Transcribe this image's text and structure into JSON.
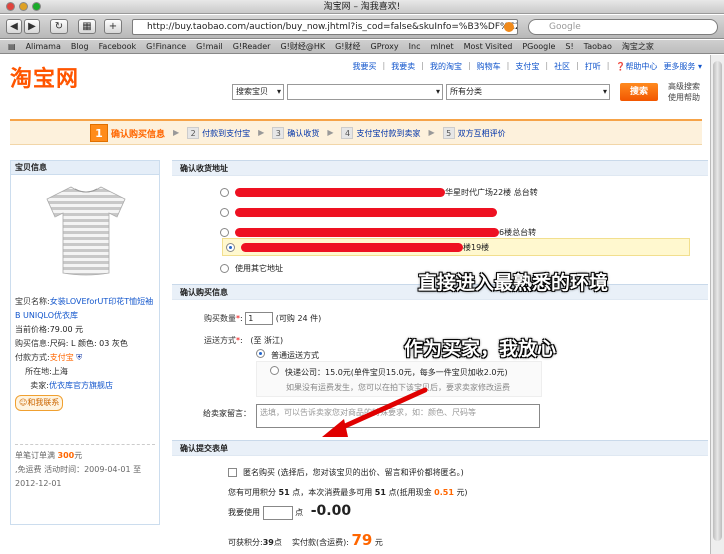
{
  "browser": {
    "window_title": "淘宝网 – 淘我喜欢!",
    "url": "http://buy.taobao.com/auction/buy_now.jhtml?is_cod=false&skuInfo=%B3%DF%C2%",
    "search_placeholder": "Google",
    "bookmarks": [
      "Alimama",
      "Blog",
      "Facebook",
      "G!Finance",
      "G!mail",
      "G!Reader",
      "G!财经@HK",
      "G!财经",
      "GProxy",
      "Inc",
      "mlnet",
      "Most Visited",
      "PGoogle",
      "S!",
      "Taobao",
      "淘宝之家"
    ]
  },
  "header": {
    "logo": "淘宝网",
    "nav": [
      "我要买",
      "我要卖",
      "我的淘宝",
      "购物车",
      "支付宝",
      "社区",
      "打听",
      "帮助中心",
      "更多服务"
    ],
    "search_type": "搜索宝贝",
    "category": "所有分类",
    "search_button": "搜索",
    "adv_search": "高级搜索",
    "help_link": "使用帮助"
  },
  "steps": [
    {
      "num": "1",
      "label": "确认购买信息",
      "active": true
    },
    {
      "num": "2",
      "label": "付款到支付宝"
    },
    {
      "num": "3",
      "label": "确认收货"
    },
    {
      "num": "4",
      "label": "支付宝付款到卖家"
    },
    {
      "num": "5",
      "label": "双方互相评价"
    }
  ],
  "product": {
    "header": "宝贝信息",
    "name_label": "宝贝名称:",
    "name": "女装LOVEforUT印花T恤短袖B UNIQLO优衣库",
    "price_label": "当前价格:",
    "price": "79.00 元",
    "attr_label": "购买信息:",
    "attr": "尺码: L 颜色: 03 灰色",
    "pay_label": "付款方式:",
    "pay": "支付宝",
    "loc_label": "所在地:",
    "loc": "上海",
    "seller_label": "卖家:",
    "seller": "优衣库官方旗舰店",
    "contact": "和我联系",
    "promo_line1_prefix": "单笔订单满 ",
    "promo_amount": "300",
    "promo_line1_suffix": "元",
    "promo_line2": ",免运费 活动时间：2009-04-01 至 2012-12-01"
  },
  "address": {
    "title": "确认收货地址",
    "rows": [
      {
        "text": "华星时代广场22楼 总台转",
        "selected": false
      },
      {
        "text": "",
        "selected": false
      },
      {
        "text": "6楼总台转",
        "selected": false
      },
      {
        "text": "楼19楼",
        "selected": true
      }
    ],
    "other": "使用其它地址"
  },
  "purchase": {
    "title": "确认购买信息",
    "qty_label": "购买数量",
    "qty": "1",
    "qty_note": "(可购 24 件)",
    "ship_label": "运送方式",
    "ship_from": "(至 浙江)",
    "ship_opt1": "普通运送方式",
    "ship_opt2": "快递公司：15.0元(单件宝贝15.0元，每多一件宝贝加收2.0元)",
    "ship_note": "如果没有运费发生，您可以在拍下该宝贝后，要求卖家修改运费",
    "msg_label": "给卖家留言：",
    "msg_placeholder": "选填，可以告诉卖家您对商品的特殊要求，如：颜色、尺码等"
  },
  "submit": {
    "title": "确认提交表单",
    "anon": "匿名购买",
    "anon_note": "(选择后，您对该宝贝的出价、留言和评价都将匿名。)",
    "points_prefix": "您有可用积分",
    "points": "51",
    "points_mid": "点，本次消费最多可用",
    "points_max": "51",
    "points_cash_prefix": "点(抵用现金",
    "points_cash": "0.51",
    "points_cash_suffix": "元)",
    "use_label": "我要使用",
    "use_unit": "点",
    "use_value": "-0.00",
    "earn_label": "可获积分:",
    "earn": "39",
    "earn_unit": "点",
    "pay_label": "实付款(含运费):",
    "pay": "79",
    "pay_unit": "元"
  },
  "annotations": {
    "a1": "直接进入最熟悉的环境",
    "a2": "作为买家，我放心"
  }
}
